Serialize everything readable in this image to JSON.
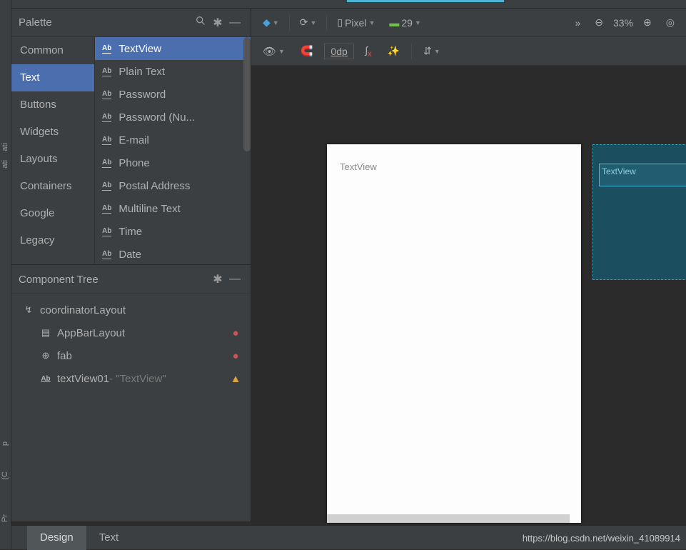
{
  "left_strip": {
    "t1": "ati",
    "t2": "ati",
    "t3": "p",
    "t4": "(C",
    "t5": "Pr"
  },
  "palette": {
    "title": "Palette",
    "search_icon": "search",
    "gear_icon": "settings",
    "minimize_icon": "minimize",
    "categories": [
      "Common",
      "Text",
      "Buttons",
      "Widgets",
      "Layouts",
      "Containers",
      "Google",
      "Legacy"
    ],
    "selected_category": "Text",
    "items": [
      "TextView",
      "Plain Text",
      "Password",
      "Password (Nu...",
      "E-mail",
      "Phone",
      "Postal Address",
      "Multiline Text",
      "Time",
      "Date"
    ],
    "selected_item": "TextView"
  },
  "component_tree": {
    "title": "Component Tree",
    "gear_icon": "settings",
    "minimize_icon": "minimize",
    "rows": [
      {
        "indent": 0,
        "icon": "↯",
        "label": "coordinatorLayout",
        "suffix": "",
        "badge": ""
      },
      {
        "indent": 1,
        "icon": "▤",
        "label": "AppBarLayout",
        "suffix": "",
        "badge": "err"
      },
      {
        "indent": 1,
        "icon": "⊕",
        "label": "fab",
        "suffix": "",
        "badge": "err"
      },
      {
        "indent": 1,
        "icon": "Ab",
        "label": "textView01",
        "suffix": "- \"TextView\"",
        "badge": "warn"
      }
    ]
  },
  "design_toolbar": {
    "surface": "layers",
    "orientation": "rotate",
    "device_label": "Pixel",
    "api_label": "29",
    "overflow": "»",
    "zoom_out": "−",
    "zoom_pct": "33%",
    "zoom_in": "+",
    "fit": "fit"
  },
  "design_toolbar2": {
    "view_options": "eye",
    "magnet": "magnet",
    "default_margin": "0dp",
    "clear_constraints": "clear",
    "infer": "wand",
    "align": "align"
  },
  "canvas": {
    "textview_label": "TextView",
    "blueprint_textview": "TextView",
    "blueprint_dim": "20"
  },
  "footer": {
    "tab_design": "Design",
    "tab_text": "Text",
    "watermark": "https://blog.csdn.net/weixin_41089914"
  }
}
